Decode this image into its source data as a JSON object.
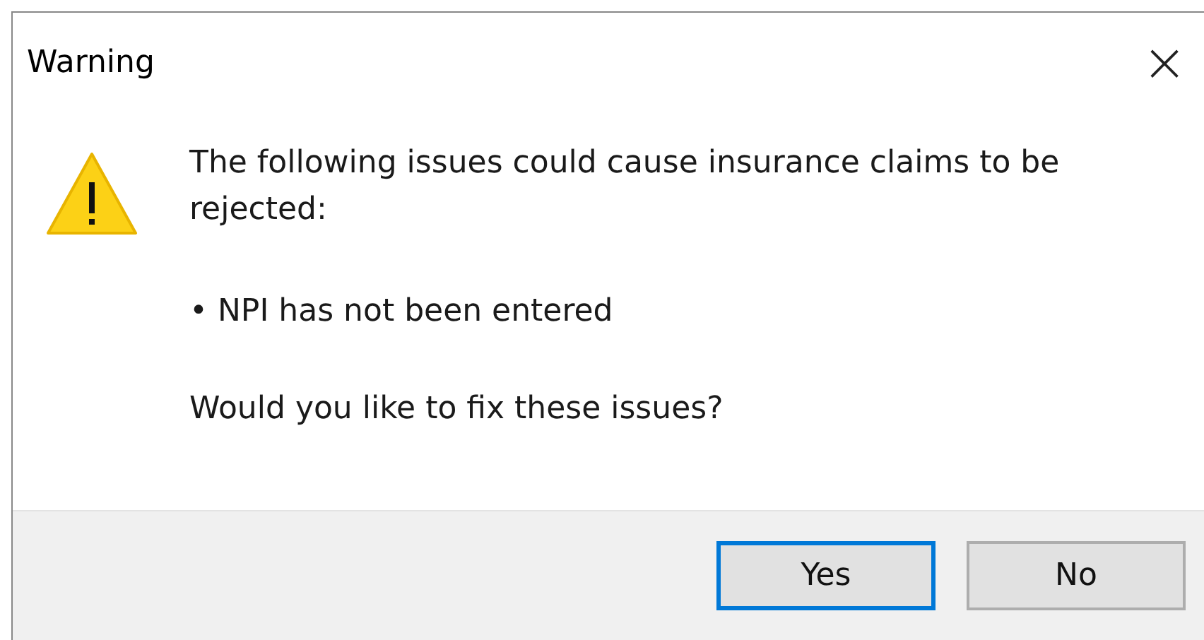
{
  "window": {
    "title": "Warning",
    "close": "×"
  },
  "message": {
    "intro": "The following issues could cause insurance claims to be rejected:",
    "issues": [
      "• NPI has not been entered"
    ],
    "question": "Would you like to fix these issues?"
  },
  "buttons": [
    {
      "label": "Yes",
      "focused": true
    },
    {
      "label": "No",
      "focused": false
    }
  ]
}
